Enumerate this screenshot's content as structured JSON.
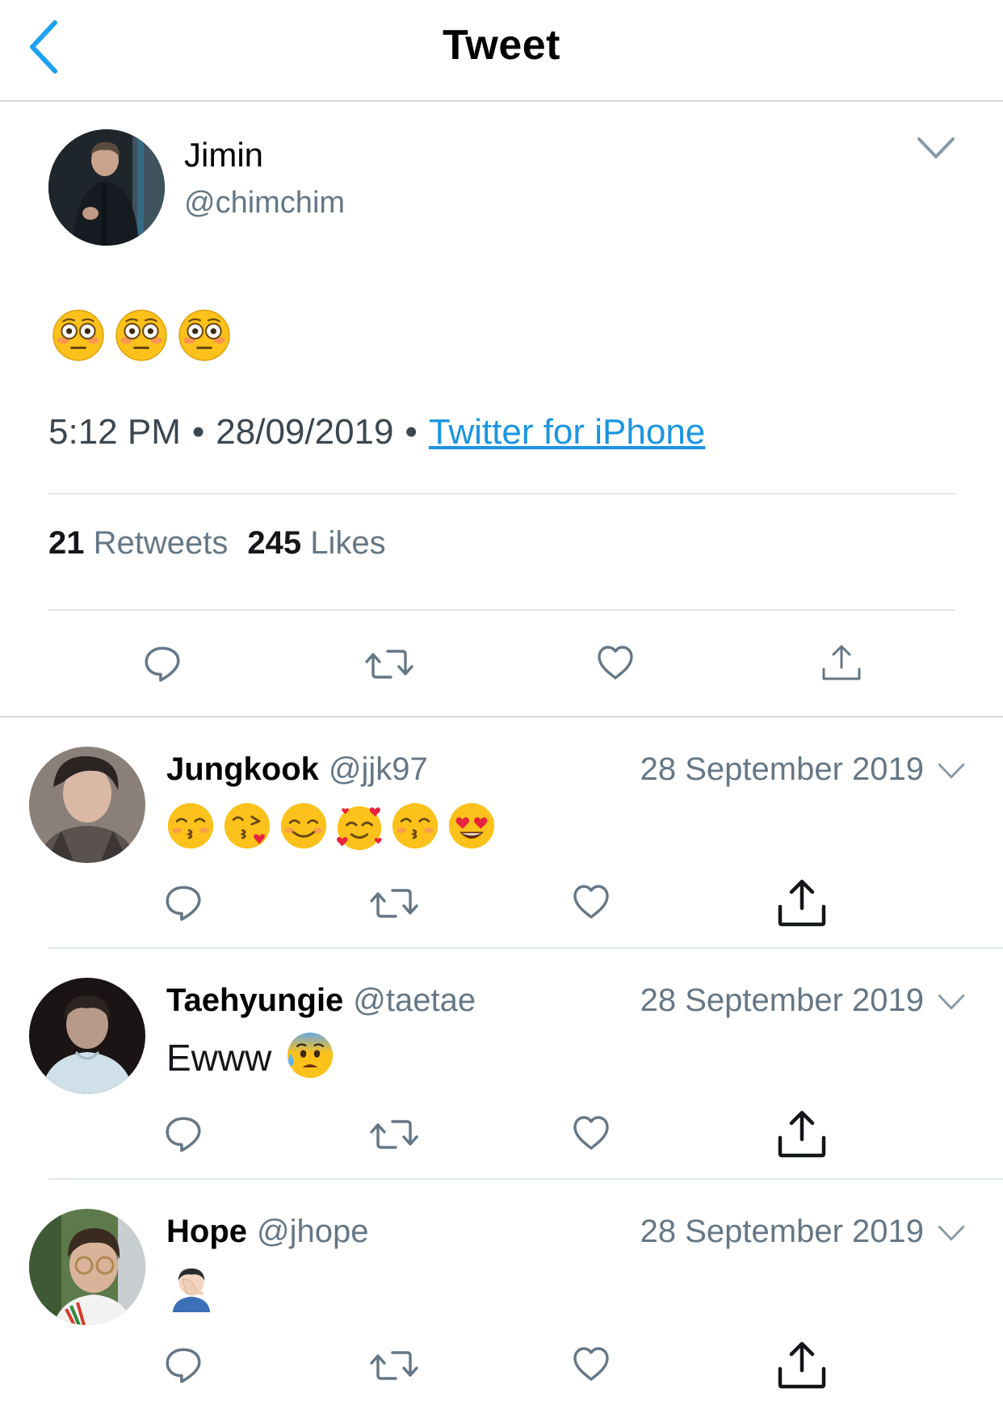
{
  "header": {
    "title": "Tweet"
  },
  "main_tweet": {
    "name": "Jimin",
    "handle": "@chimchim",
    "content_icons": [
      "flushed-face-emoji",
      "flushed-face-emoji",
      "flushed-face-emoji"
    ],
    "time": "5:12 PM",
    "date": "28/09/2019",
    "source": "Twitter for iPhone",
    "retweets_count": "21",
    "retweets_label": "Retweets",
    "likes_count": "245",
    "likes_label": "Likes"
  },
  "replies": [
    {
      "name": "Jungkook",
      "handle": "@jjk97",
      "date": "28 September 2019",
      "text": "",
      "content_icons": [
        "kissing-smiling-eyes-emoji",
        "face-blowing-kiss-emoji",
        "smiling-face-emoji",
        "smiling-face-with-hearts-emoji",
        "kissing-smiling-eyes-emoji",
        "heart-eyes-emoji"
      ]
    },
    {
      "name": "Taehyungie",
      "handle": "@taetae",
      "date": "28 September 2019",
      "text": "Ewww",
      "content_icons": [
        "anxious-face-with-sweat-emoji"
      ]
    },
    {
      "name": "Hope",
      "handle": "@jhope",
      "date": "28 September 2019",
      "text": "",
      "content_icons": [
        "man-facepalming-emoji"
      ]
    }
  ],
  "colors": {
    "link": "#1b95e0",
    "secondary_text": "#657786",
    "icon": "#657786",
    "divider": "#e1e8ed",
    "emoji_yellow": "#fcc21b"
  },
  "icons": {
    "back": "chevron-left-icon",
    "caret": "chevron-down-icon",
    "reply": "reply-icon",
    "retweet": "retweet-icon",
    "like": "heart-icon",
    "share": "share-icon"
  }
}
